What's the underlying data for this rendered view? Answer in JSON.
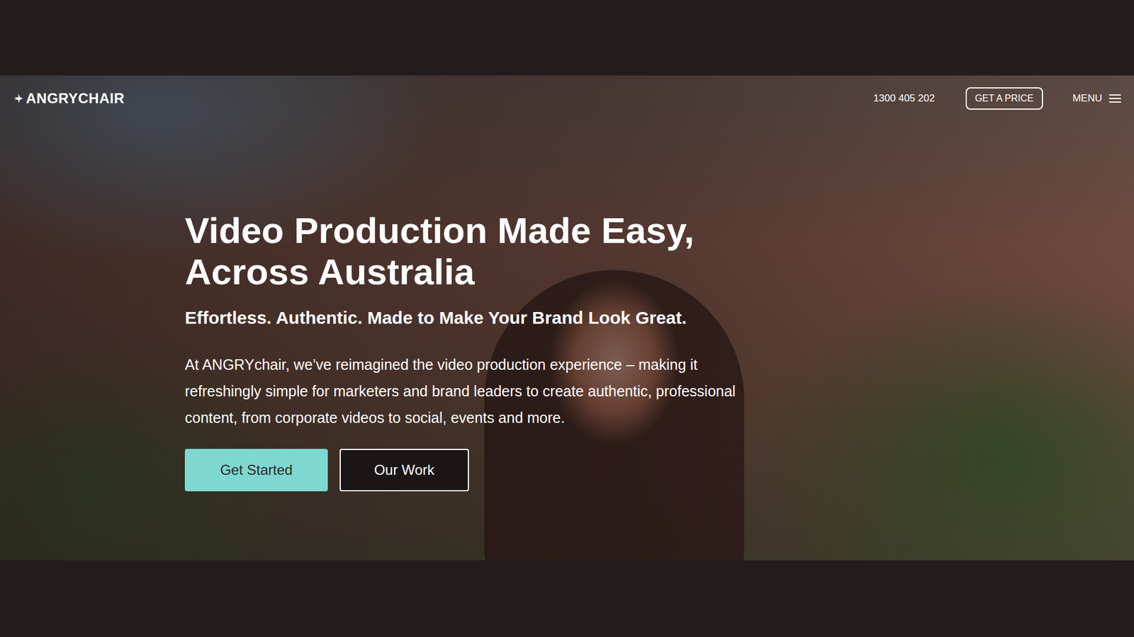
{
  "nav": {
    "logo": "ANGRYCHAIR",
    "phone": "1300 405 202",
    "cta": "GET A PRICE",
    "menu": "MENU"
  },
  "hero": {
    "heading": [
      "Video Production Made Easy,",
      "Across Australia"
    ],
    "subheading": "Effortless. Authentic. Made to Make Your Brand Look Great.",
    "body": "At ANGRYchair, we’ve reimagined the video production experience – making it refreshingly simple for marketers and brand leaders to create authentic, professional content, from corporate videos to social, events and more.",
    "buttons": [
      {
        "label": "Get Started",
        "kind": "primary"
      },
      {
        "label": "Our Work",
        "kind": "secondary"
      }
    ]
  }
}
